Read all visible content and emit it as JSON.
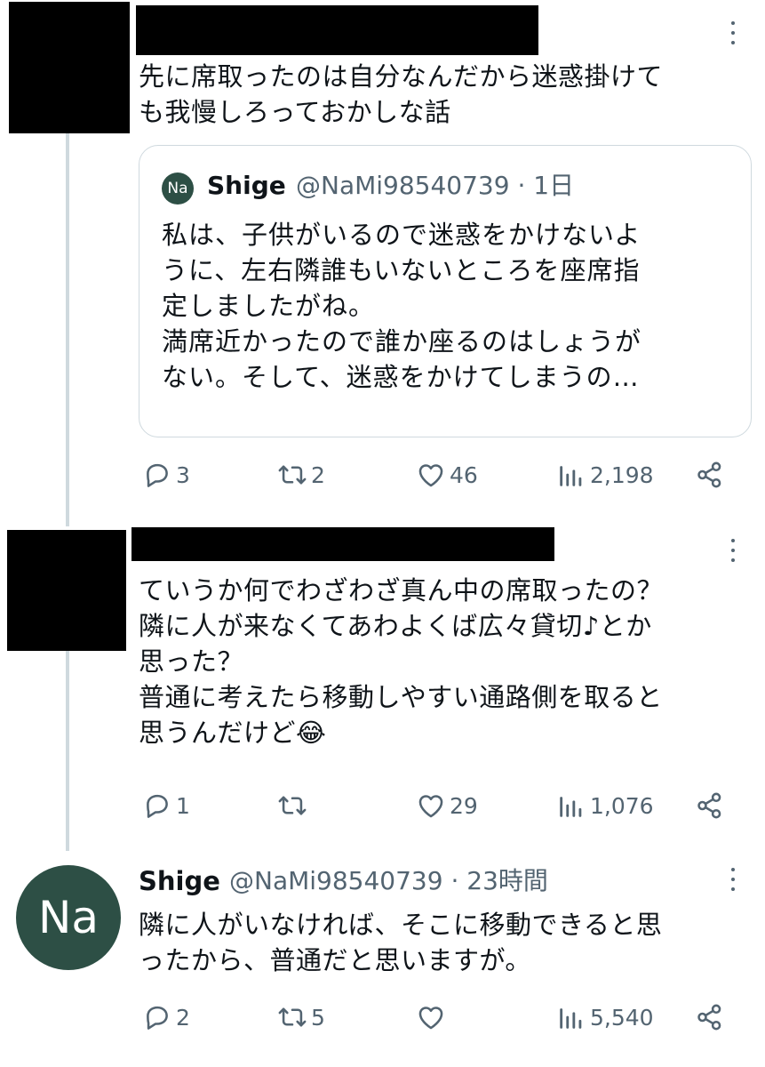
{
  "tweet1": {
    "text": "先に席取ったのは自分なんだから迷惑掛けて\nも我慢しろっておかしな話",
    "quote": {
      "avatar_text": "Na",
      "name": "Shige",
      "handle_time": "@NaMi98540739 · 1日",
      "text": "私は、子供がいるので迷惑をかけないよ\nうに、左右隣誰もいないところを座席指\n定しましたがね。\n満席近かったので誰か座るのはしょうが\nない。そして、迷惑をかけてしまうの…"
    },
    "actions": {
      "replies": "3",
      "retweets": "2",
      "likes": "46",
      "views": "2,198"
    }
  },
  "tweet2": {
    "text": "ていうか何でわざわざ真ん中の席取ったの？\n隣に人が来なくてあわよくば広々貸切♪とか\n思った？\n普通に考えたら移動しやすい通路側を取ると\n思うんだけど😂",
    "actions": {
      "replies": "1",
      "retweets": "",
      "likes": "29",
      "views": "1,076"
    }
  },
  "tweet3": {
    "avatar_text": "Na",
    "name": "Shige",
    "handle_time": "@NaMi98540739 · 23時間",
    "text": "隣に人がいなければ、そこに移動できると思\nったから、普通だと思いますが。",
    "actions": {
      "replies": "2",
      "retweets": "5",
      "likes": "",
      "views": "5,540"
    }
  },
  "colors": {
    "text": "#0f1419",
    "secondary": "#536471",
    "avatar": "#2d4f45",
    "thread_line": "#cfd9de"
  },
  "icons": [
    "reply-icon",
    "retweet-icon",
    "like-icon",
    "views-icon",
    "share-icon",
    "more-icon"
  ]
}
